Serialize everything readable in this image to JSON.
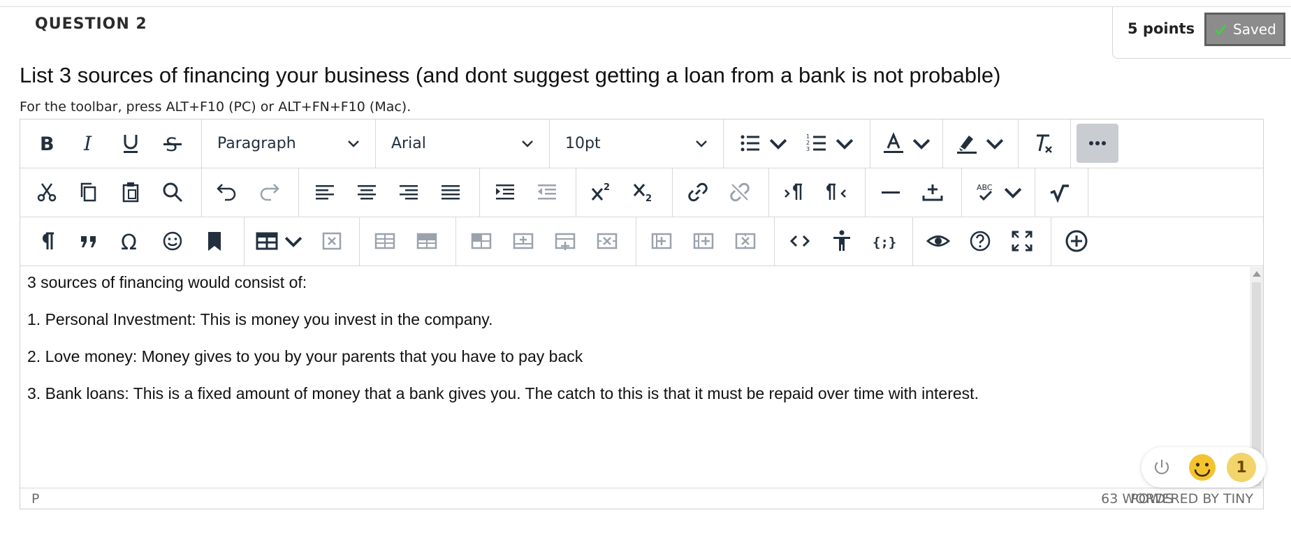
{
  "question": {
    "title": "QUESTION 2",
    "points": "5 points",
    "saved_label": "Saved",
    "prompt": "List 3 sources of financing your business (and dont suggest getting a loan from a bank  is not probable)",
    "toolbar_hint": "For the toolbar, press ALT+F10 (PC) or ALT+FN+F10 (Mac)."
  },
  "toolbar": {
    "block_format": "Paragraph",
    "font_family": "Arial",
    "font_size": "10pt"
  },
  "content": {
    "paragraphs": [
      "3 sources of financing would consist of:",
      "1.  Personal Investment: This is money you invest in the company.",
      "2. Love money: Money gives to you by your parents that you have to pay back",
      "3. Bank loans: This is a fixed amount of money that a bank gives you. The catch to this is that it must be repaid over time with interest."
    ]
  },
  "statusbar": {
    "path": "P",
    "word_count": "63 WORDS",
    "powered_by": "POWERED BY TINY"
  },
  "floating_widget": {
    "badge_count": "1"
  },
  "colors": {
    "toolbar_icon": "#222f3e",
    "disabled_icon": "#9aa2ac",
    "saved_bg": "#8c8c8c",
    "saved_check": "#3fd13f"
  }
}
